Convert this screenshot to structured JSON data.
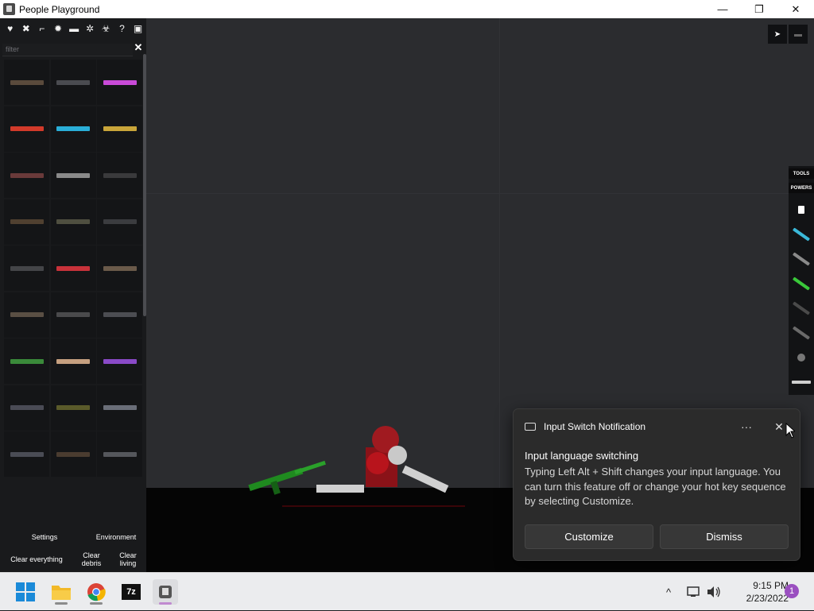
{
  "window": {
    "title": "People Playground",
    "buttons": {
      "minimize": "—",
      "restore": "❐",
      "close": "✕"
    }
  },
  "panel": {
    "categories": [
      {
        "name": "heart-icon",
        "glyph": "♥"
      },
      {
        "name": "swords-icon",
        "glyph": "✖"
      },
      {
        "name": "gun-icon",
        "glyph": "⌐"
      },
      {
        "name": "explosion-icon",
        "glyph": "✹"
      },
      {
        "name": "vehicle-icon",
        "glyph": "▬"
      },
      {
        "name": "gear-icon",
        "glyph": "✲"
      },
      {
        "name": "biohazard-icon",
        "glyph": "☣"
      },
      {
        "name": "help-icon",
        "glyph": "?"
      },
      {
        "name": "save-icon",
        "glyph": "▣"
      }
    ],
    "filter_placeholder": "filter",
    "filter_clear": "✕",
    "items": [
      {
        "name": "rifle",
        "color": "#5a4a3c"
      },
      {
        "name": "assault-rifle",
        "color": "#4a4b50"
      },
      {
        "name": "energy-gun",
        "color": "#c94ad8"
      },
      {
        "name": "red-laser",
        "color": "#d23a2a"
      },
      {
        "name": "blue-laser",
        "color": "#2aaed8"
      },
      {
        "name": "yellow-laser",
        "color": "#c9a53a"
      },
      {
        "name": "rocket-launcher",
        "color": "#6a3a3a"
      },
      {
        "name": "pistol",
        "color": "#8a8a8a"
      },
      {
        "name": "rod",
        "color": "#3a3a3c"
      },
      {
        "name": "sword",
        "color": "#504030"
      },
      {
        "name": "bat",
        "color": "#4f4f40"
      },
      {
        "name": "staff",
        "color": "#3b3c3f"
      },
      {
        "name": "shotgun",
        "color": "#444548"
      },
      {
        "name": "fire-extinguisher",
        "color": "#c8323a"
      },
      {
        "name": "minigun",
        "color": "#6a5a4a"
      },
      {
        "name": "revolver",
        "color": "#5a4f44"
      },
      {
        "name": "handgun",
        "color": "#4a4a4c"
      },
      {
        "name": "machine-gun",
        "color": "#4c4d52"
      },
      {
        "name": "green-launcher",
        "color": "#3a8a3a"
      },
      {
        "name": "plasma-rifle",
        "color": "#c6a080"
      },
      {
        "name": "purple-gun",
        "color": "#8a4ac8"
      },
      {
        "name": "sniper",
        "color": "#4a4b55"
      },
      {
        "name": "mortar",
        "color": "#5a5a2a"
      },
      {
        "name": "tech-rifle",
        "color": "#6a6e78"
      },
      {
        "name": "small-pistol",
        "color": "#4a4c55"
      },
      {
        "name": "hunting-rifle",
        "color": "#4a3c30"
      },
      {
        "name": "heavy-cannon",
        "color": "#55575c"
      }
    ],
    "bottom_buttons": {
      "settings": "Settings",
      "environment": "Environment",
      "clear_everything": "Clear everything",
      "clear_debris": "Clear debris",
      "clear_living": "Clear living"
    }
  },
  "tool_strip": {
    "tabs": [
      "TOOLS",
      "POWERS"
    ],
    "tools": [
      {
        "name": "pointer-tool",
        "color": "#ffffff"
      },
      {
        "name": "drag-tool",
        "color": "#3ab8d8"
      },
      {
        "name": "cable-tool",
        "color": "#8a8a8a"
      },
      {
        "name": "spring-tool",
        "color": "#3ac83a"
      },
      {
        "name": "rope-tool",
        "color": "#4a4a4a"
      },
      {
        "name": "chain-tool",
        "color": "#6a6a6a"
      },
      {
        "name": "ball-tool",
        "color": "#777777"
      },
      {
        "name": "sparkle-tool",
        "color": "#cfcfcf"
      }
    ]
  },
  "notification": {
    "app": "Input Switch Notification",
    "more": "···",
    "close": "✕",
    "title": "Input language switching",
    "body": "Typing Left Alt + Shift changes your input language. You can turn this feature off or change your hot key sequence by selecting Customize.",
    "buttons": {
      "customize": "Customize",
      "dismiss": "Dismiss"
    }
  },
  "taskbar": {
    "apps": [
      {
        "name": "start-button",
        "label": "Start"
      },
      {
        "name": "file-explorer",
        "label": "File Explorer"
      },
      {
        "name": "chrome",
        "label": "Google Chrome"
      },
      {
        "name": "7zip",
        "label": "7z"
      },
      {
        "name": "people-playground",
        "label": "People Playground"
      }
    ],
    "sevenzip_text": "7z",
    "chevron": "^",
    "clock": {
      "time": "9:15 PM",
      "date": "2/23/2022"
    },
    "notification_count": "1"
  }
}
